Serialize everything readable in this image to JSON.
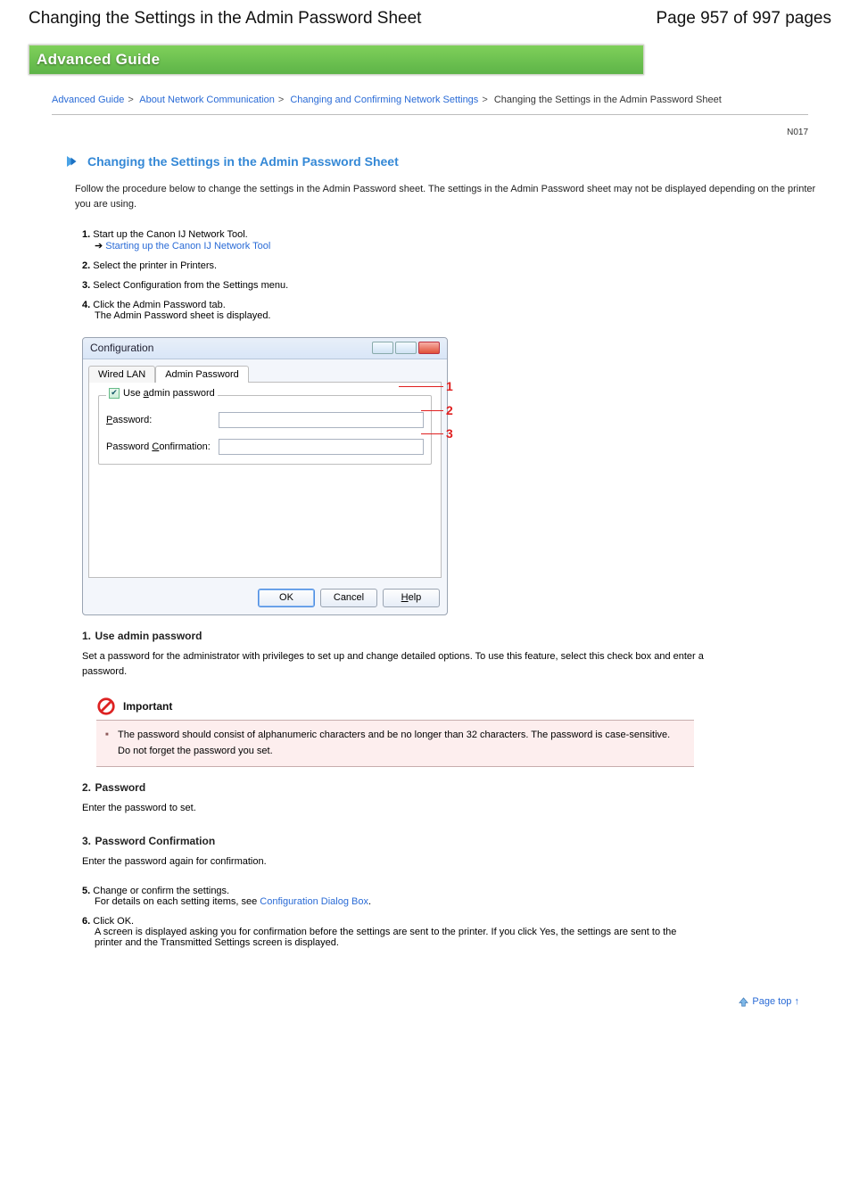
{
  "header": {
    "title_left": "Changing the Settings in the Admin Password Sheet",
    "title_right": "Page 957 of 997 pages"
  },
  "banner": {
    "title": "Advanced Guide"
  },
  "breadcrumb": {
    "items": [
      "Advanced Guide",
      "About Network Communication",
      "Changing and Confirming Network Settings"
    ],
    "current": "Changing the Settings in the Admin Password Sheet"
  },
  "idline": "N017",
  "h1": "Changing the Settings in the Admin Password Sheet",
  "lead": "Follow the procedure below to change the settings in the Admin Password sheet. The settings in the Admin Password sheet may not be displayed depending on the printer you are using.",
  "steps": {
    "s1": {
      "label": "1.",
      "body": "Start up the Canon IJ Network Tool.",
      "link": "Starting up the Canon IJ Network Tool"
    },
    "s2": {
      "label": "2.",
      "body": "Select the printer in Printers."
    },
    "s3": {
      "label": "3.",
      "body": "Select Configuration from the Settings menu."
    },
    "s4": {
      "label": "4.",
      "body": "Click the Admin Password tab.",
      "sub": "The Admin Password sheet is displayed."
    }
  },
  "dialog": {
    "title": "Configuration",
    "tabs": {
      "t1": "Wired LAN",
      "t2": "Admin Password"
    },
    "legend": "Use admin password",
    "fields": {
      "pw": "Password:",
      "cf": "Password Confirmation:"
    },
    "buttons": {
      "ok": "OK",
      "cancel": "Cancel",
      "help": "Help"
    }
  },
  "callouts": {
    "c1": "1",
    "c2": "2",
    "c3": "3"
  },
  "descriptions": {
    "d1": {
      "num": "1.",
      "title": "Use admin password",
      "body": "Set a password for the administrator with privileges to set up and change detailed options. To use this feature, select this check box and enter a password."
    },
    "important": {
      "label": "Important",
      "body": "The password should consist of alphanumeric characters and be no longer than 32 characters. The password is case-sensitive. Do not forget the password you set."
    },
    "d2": {
      "num": "2.",
      "title": "Password",
      "body": "Enter the password to set."
    },
    "d3": {
      "num": "3.",
      "title": "Password Confirmation",
      "body": "Enter the password again for confirmation."
    }
  },
  "step5": {
    "label": "5.",
    "body": "Change or confirm the settings.",
    "sub": "For details on each setting items, see ",
    "link": "Configuration Dialog Box"
  },
  "step6": {
    "label": "6.",
    "body": "Click OK.",
    "sub": "A screen is displayed asking you for confirmation before the settings are sent to the printer. If you click Yes, the settings are sent to the printer and the Transmitted Settings screen is displayed."
  },
  "toplink": "Page top"
}
